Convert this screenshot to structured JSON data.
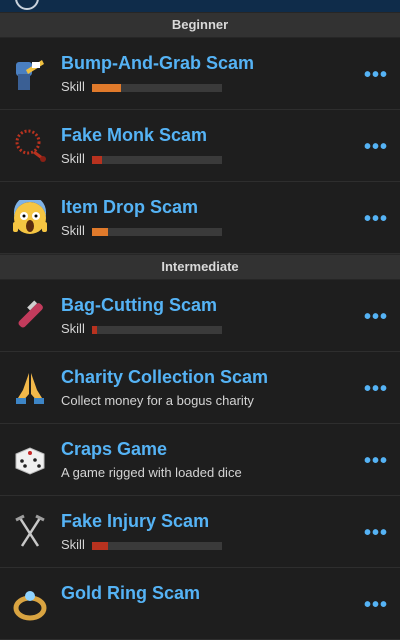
{
  "sections": [
    {
      "title": "Beginner",
      "items": [
        {
          "title": "Bump-And-Grab Scam",
          "subtitle": "Skill",
          "skill": 0.22,
          "color": "#e07a2b",
          "icon": "thief-icon"
        },
        {
          "title": "Fake Monk Scam",
          "subtitle": "Skill",
          "skill": 0.08,
          "color": "#b8321f",
          "icon": "prayer-beads-icon"
        },
        {
          "title": "Item Drop Scam",
          "subtitle": "Skill",
          "skill": 0.12,
          "color": "#e07a2b",
          "icon": "scream-face-icon"
        }
      ]
    },
    {
      "title": "Intermediate",
      "items": [
        {
          "title": "Bag-Cutting Scam",
          "subtitle": "Skill",
          "skill": 0.04,
          "color": "#b8321f",
          "icon": "box-cutter-icon"
        },
        {
          "title": "Charity Collection Scam",
          "subtitle": "Collect money for a bogus charity",
          "icon": "praying-hands-icon"
        },
        {
          "title": "Craps Game",
          "subtitle": "A game rigged with loaded dice",
          "icon": "dice-icon"
        },
        {
          "title": "Fake Injury Scam",
          "subtitle": "Skill",
          "skill": 0.12,
          "color": "#b8321f",
          "icon": "crutches-icon"
        },
        {
          "title": "Gold Ring Scam",
          "subtitle": "",
          "icon": "gold-ring-icon"
        }
      ]
    }
  ],
  "more_label": "•••"
}
